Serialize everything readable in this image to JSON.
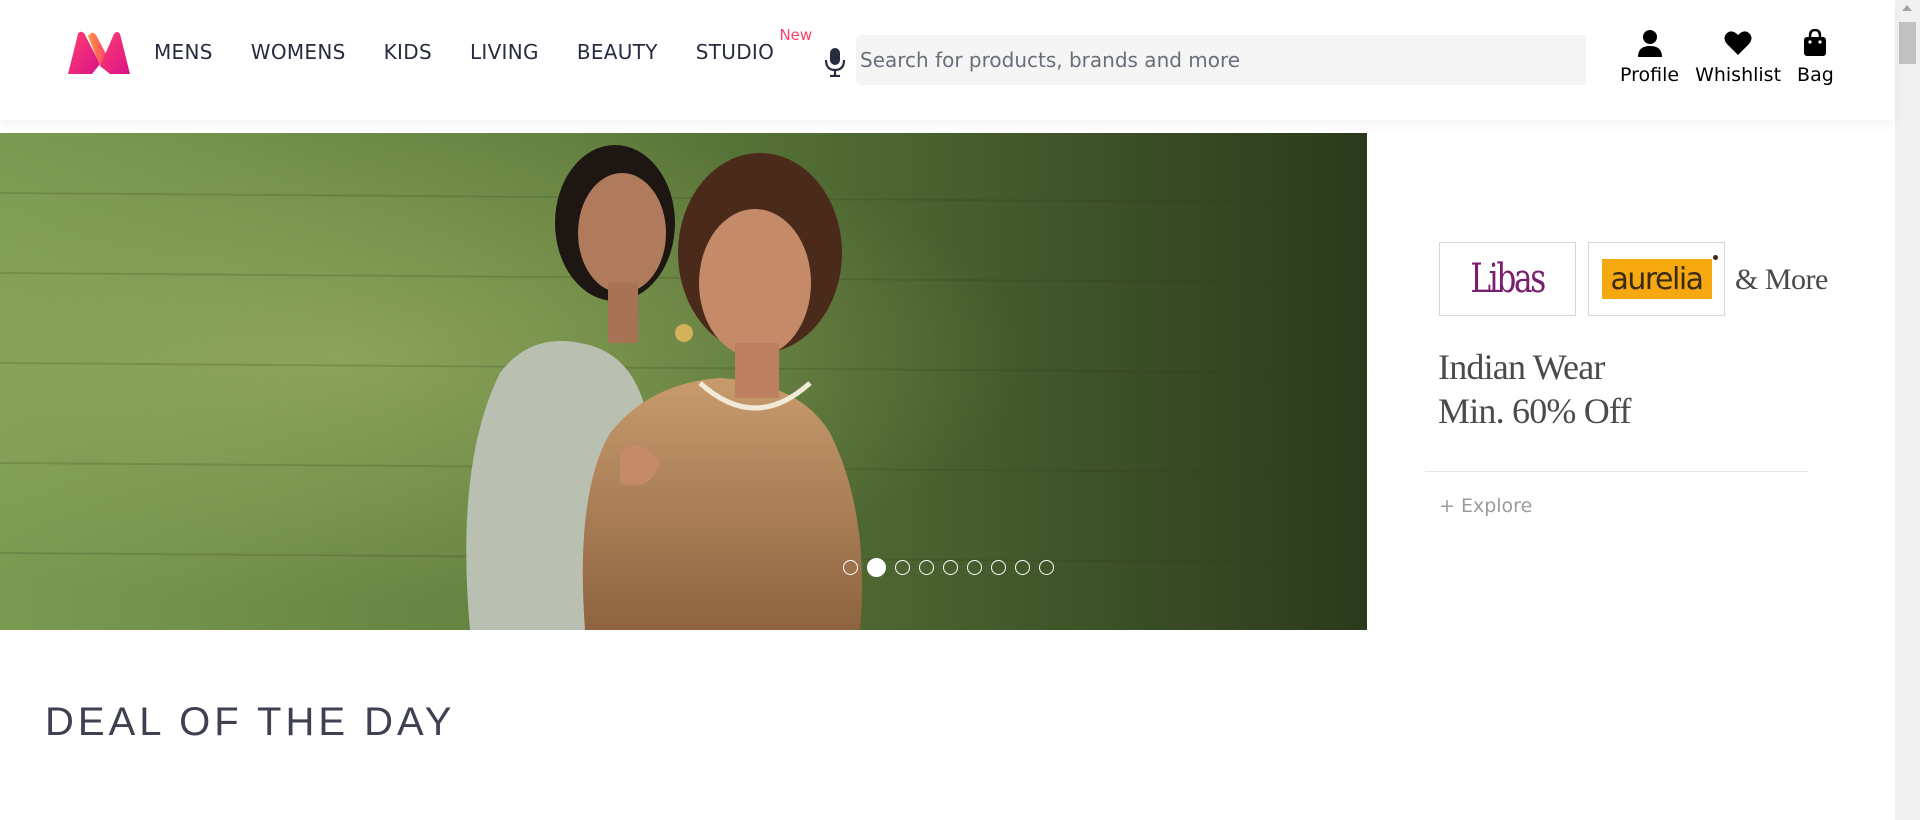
{
  "brand": {
    "accent": "#ff3f6c",
    "text": "#282c3f"
  },
  "header": {
    "logo": "myntra-logo",
    "nav": [
      {
        "label": "MENS"
      },
      {
        "label": "WOMENS"
      },
      {
        "label": "KIDS"
      },
      {
        "label": "LIVING"
      },
      {
        "label": "BEAUTY"
      },
      {
        "label": "STUDIO",
        "tag": "New"
      }
    ],
    "search": {
      "placeholder": "Search for products, brands and more",
      "value": "",
      "icon": "mic-icon"
    },
    "actions": [
      {
        "label": "Profile",
        "icon": "profile-icon"
      },
      {
        "label": "Whishlist",
        "icon": "heart-icon"
      },
      {
        "label": "Bag",
        "icon": "bag-icon"
      }
    ]
  },
  "hero": {
    "slide_count": 9,
    "active_slide": 2
  },
  "promo": {
    "brands": [
      "Libas",
      "aurelia"
    ],
    "more": "& More",
    "title_line1": "Indian Wear",
    "title_line2": "Min. 60% Off",
    "cta": "+ Explore"
  },
  "section": {
    "title": "DEAL OF THE DAY"
  }
}
